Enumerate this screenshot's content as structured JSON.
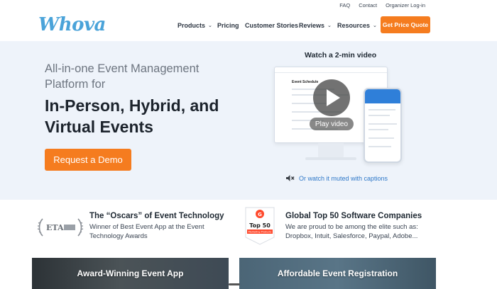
{
  "utility_nav": {
    "faq": "FAQ",
    "contact": "Contact",
    "organizer_login": "Organizer Log-in"
  },
  "brand": {
    "logo_text": "Whova",
    "accent": "#f57c1f",
    "logo_color": "#4aa3d9"
  },
  "main_nav": {
    "products": "Products",
    "pricing": "Pricing",
    "customer_stories": "Customer Stories",
    "reviews": "Reviews",
    "resources": "Resources",
    "quote_button": "Get Price Quote"
  },
  "hero": {
    "subtitle": "All-in-one Event Management Platform for",
    "title": "In-Person, Hybrid, and Virtual Events",
    "demo_button": "Request a Demo",
    "video_label": "Watch a 2-min video",
    "play_label": "Play video",
    "muted_link": "Or watch it muted with captions",
    "mock_screen_title": "Event Schedule"
  },
  "awards": {
    "eta": {
      "title": "The “Oscars” of Event Technology",
      "text": "Winner of Best Event App at the Event Technology Awards",
      "logo_text": "ETA"
    },
    "g2": {
      "title": "Global Top 50 Software Companies",
      "text": "We are proud to be among the elite such as: Dropbox, Intuit, Salesforce, Paypal, Adobe...",
      "badge_title": "Top 50",
      "badge_sub": "Marketing Products"
    }
  },
  "cards": {
    "left": "Award-Winning Event App",
    "right": "Affordable Event Registration"
  }
}
